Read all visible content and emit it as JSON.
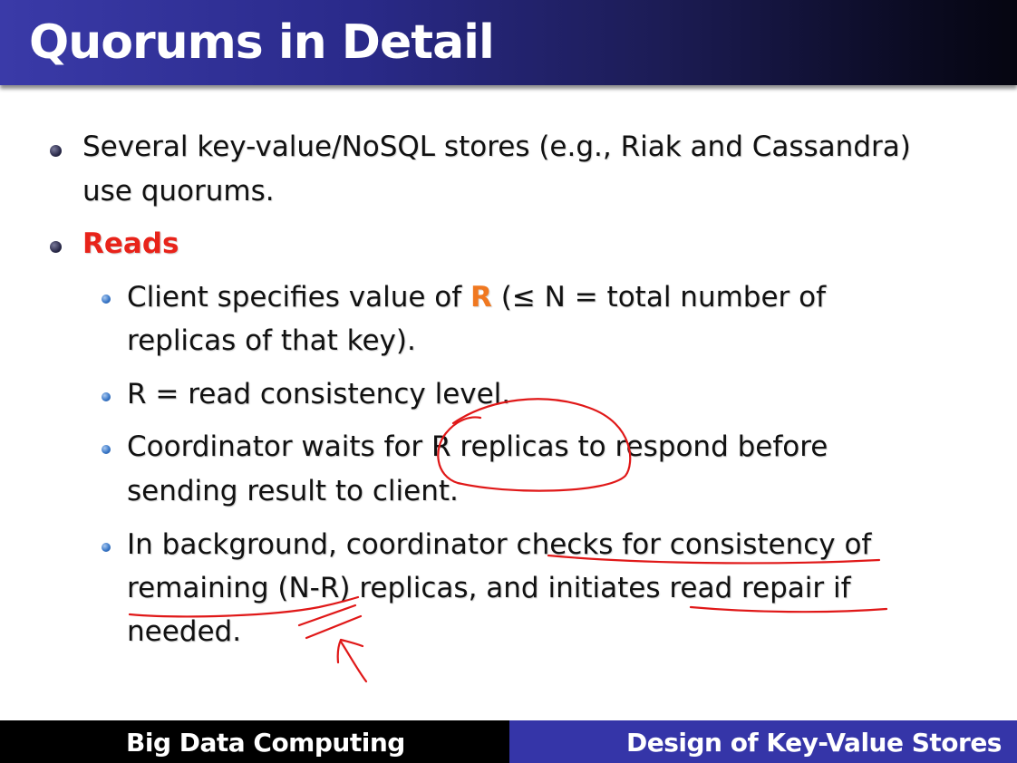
{
  "slide": {
    "title": "Quorums in Detail"
  },
  "bullets": {
    "b1": "Several key-value/NoSQL stores (e.g., Riak and Cassandra)",
    "b1_cont": "use quorums.",
    "b2": "Reads",
    "s1_a": "Client specifies value of ",
    "s1_r": "R",
    "s1_b": " (≤ N = total number of",
    "s1_cont": "replicas of that key).",
    "s2": "R = read consistency level.",
    "s3": "Coordinator waits for R replicas to respond before",
    "s3_cont": "sending result to client.",
    "s4": "In background, coordinator checks for consistency of",
    "s4_cont": "remaining (N-R) replicas, and initiates read repair if",
    "s4_cont2": "needed."
  },
  "footer": {
    "left": "Big Data Computing",
    "right": "Design of Key-Value Stores"
  },
  "colors": {
    "header_start": "#3a3aa8",
    "header_end": "#050510",
    "emphasis_red": "#e8231a",
    "emphasis_orange": "#f07820",
    "ink_red": "#e01818",
    "footer_left_bg": "#000000",
    "footer_right_bg": "#3535a8"
  }
}
